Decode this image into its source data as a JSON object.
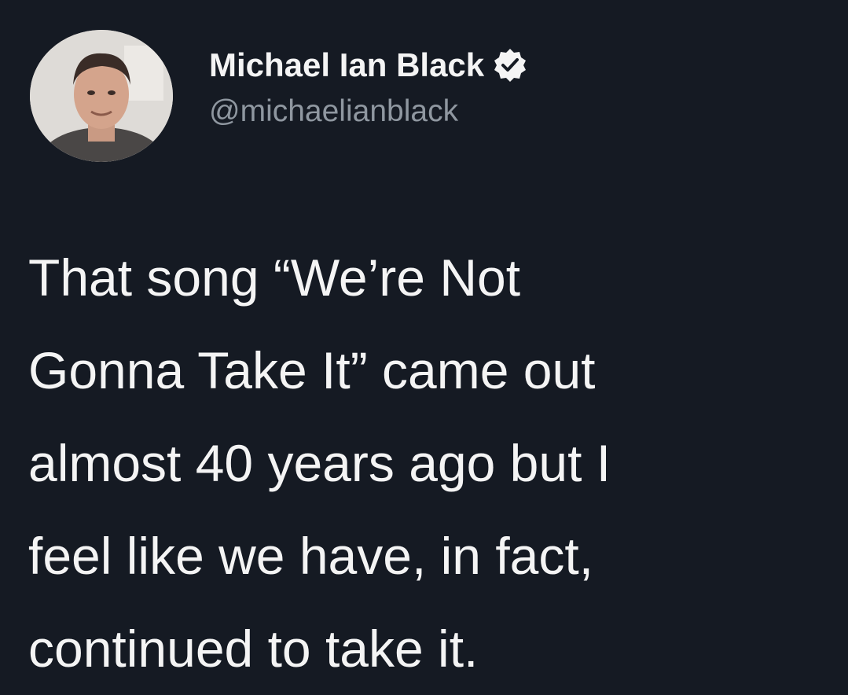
{
  "tweet": {
    "author": {
      "display_name": "Michael Ian Black",
      "handle": "@michaelianblack",
      "verified": true,
      "avatar_icon": "profile-photo"
    },
    "text_lines": [
      "That song “We’re Not",
      "Gonna Take It” came out",
      "almost 40 years ago but I",
      "feel like we have, in fact,",
      "continued to take it."
    ]
  },
  "colors": {
    "background": "#151a23",
    "text": "#f4f4f4",
    "handle": "#8f97a0"
  }
}
